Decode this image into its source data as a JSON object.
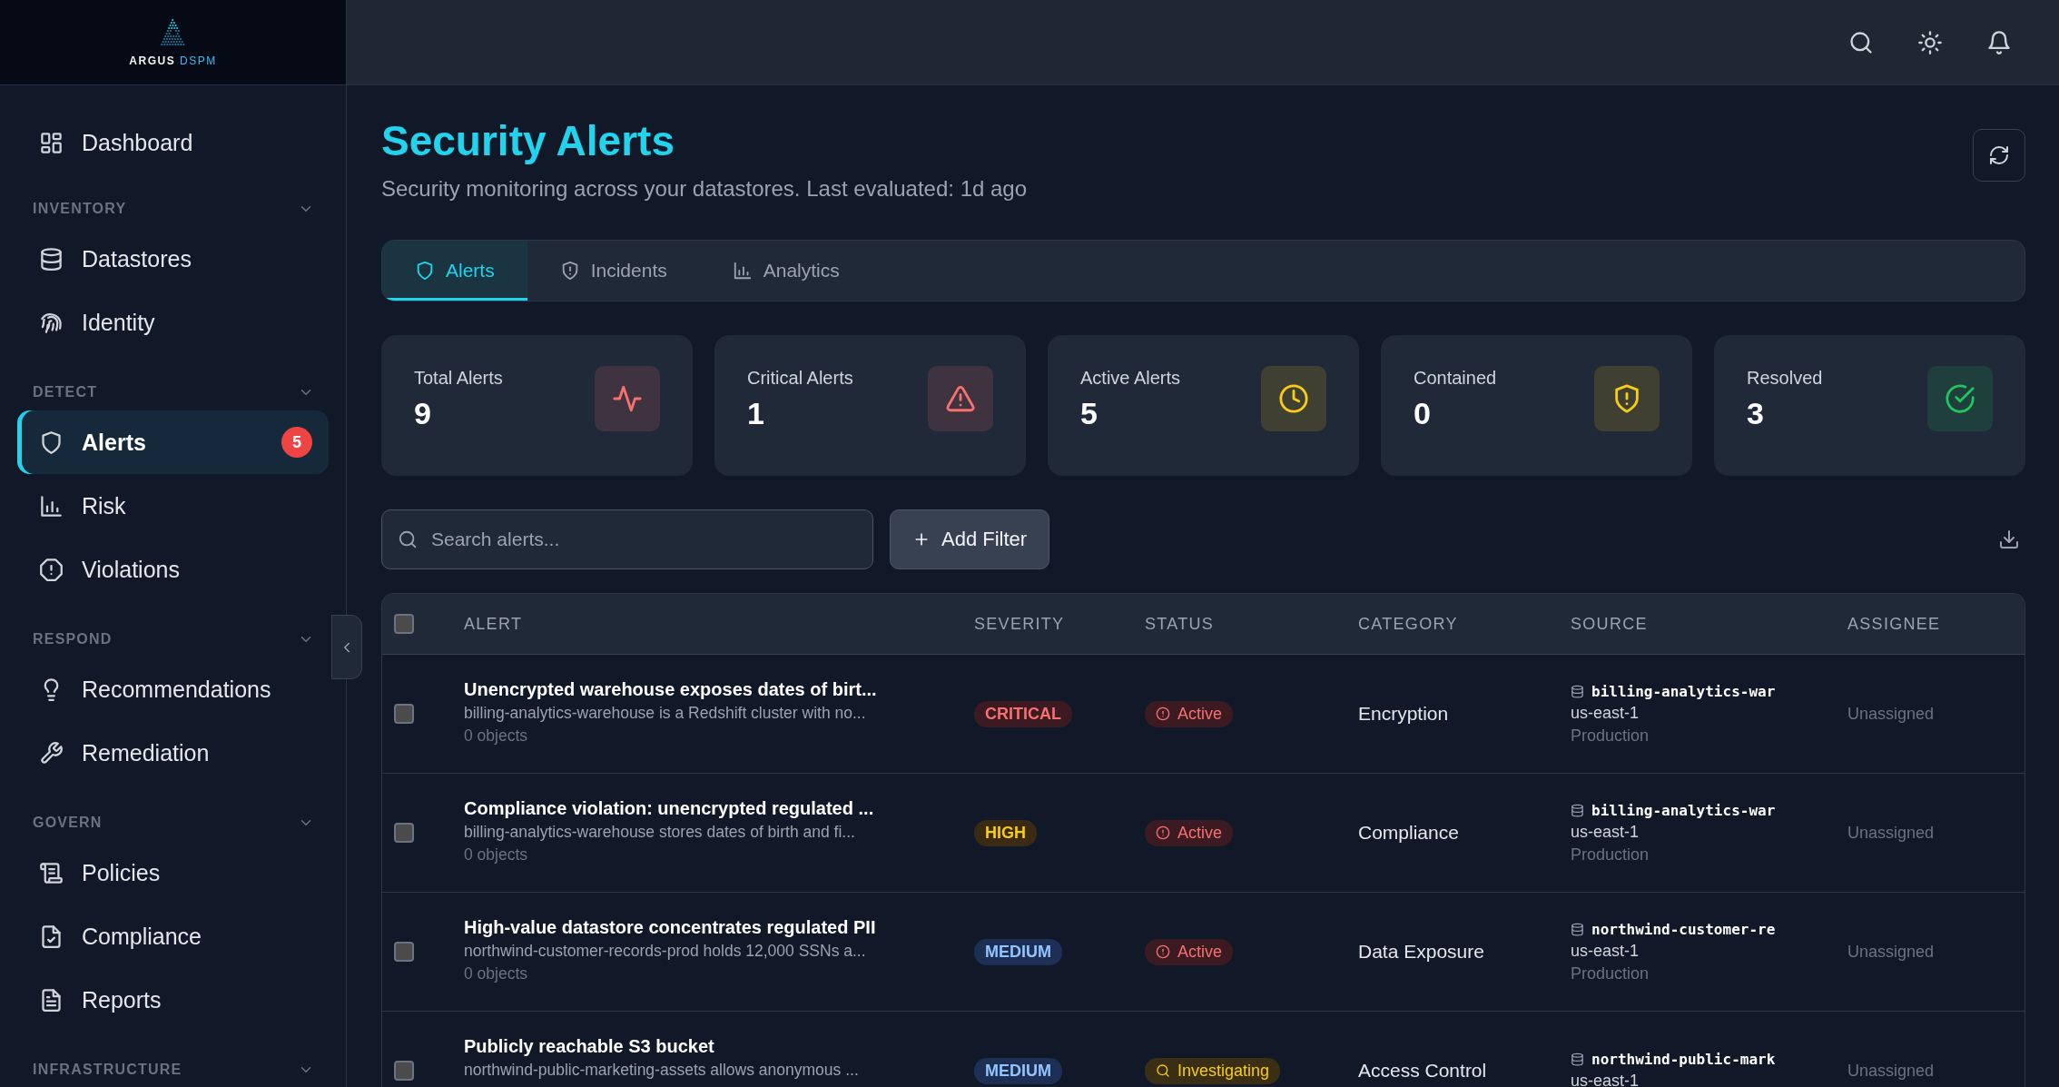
{
  "brand": {
    "name": "ARGUS",
    "product": "DSPM"
  },
  "sidebar": {
    "items": [
      {
        "label": "Dashboard",
        "selected": false
      }
    ],
    "sections": [
      {
        "label": "INVENTORY",
        "expanded": true,
        "items": [
          {
            "label": "Datastores",
            "selected": false
          },
          {
            "label": "Identity",
            "selected": false
          }
        ]
      },
      {
        "label": "DETECT",
        "expanded": true,
        "items": [
          {
            "label": "Alerts",
            "selected": true,
            "badge": "5"
          },
          {
            "label": "Risk",
            "selected": false
          },
          {
            "label": "Violations",
            "selected": false
          }
        ]
      },
      {
        "label": "RESPOND",
        "expanded": true,
        "items": [
          {
            "label": "Recommendations",
            "selected": false
          },
          {
            "label": "Remediation",
            "selected": false
          }
        ]
      },
      {
        "label": "GOVERN",
        "expanded": true,
        "items": [
          {
            "label": "Policies",
            "selected": false
          },
          {
            "label": "Compliance",
            "selected": false
          },
          {
            "label": "Reports",
            "selected": false
          }
        ]
      },
      {
        "label": "INFRASTRUCTURE",
        "expanded": true
      }
    ]
  },
  "header": {
    "title": "Security Alerts",
    "subtitle": "Security monitoring across your datastores. Last evaluated: 1d ago"
  },
  "tabs": [
    {
      "label": "Alerts",
      "selected": true
    },
    {
      "label": "Incidents",
      "selected": false
    },
    {
      "label": "Analytics",
      "selected": false
    }
  ],
  "stats": [
    {
      "label": "Total Alerts",
      "value": "9",
      "color": "#f87171"
    },
    {
      "label": "Critical Alerts",
      "value": "1",
      "color": "#f87171"
    },
    {
      "label": "Active Alerts",
      "value": "5",
      "color": "#facc15"
    },
    {
      "label": "Contained",
      "value": "0",
      "color": "#facc15"
    },
    {
      "label": "Resolved",
      "value": "3",
      "color": "#22c55e"
    }
  ],
  "toolbar": {
    "search": {
      "placeholder": "Search alerts..."
    },
    "add_filter": "Add Filter"
  },
  "table": {
    "select_all": {
      "checked": false
    },
    "columns": [
      "ALERT",
      "SEVERITY",
      "STATUS",
      "CATEGORY",
      "SOURCE",
      "ASSIGNEE"
    ],
    "rows": [
      {
        "checked": false,
        "title": "Unencrypted warehouse exposes dates of birt...",
        "description": "billing-analytics-warehouse is a Redshift cluster with no...",
        "meta": "0 objects",
        "severity": {
          "label": "CRITICAL",
          "kind": "critical"
        },
        "status": {
          "label": "Active",
          "kind": "active"
        },
        "category": "Encryption",
        "source": {
          "name": "billing-analytics-war",
          "region": "us-east-1",
          "environment": "Production"
        },
        "assignee": "Unassigned"
      },
      {
        "checked": false,
        "title": "Compliance violation: unencrypted regulated ...",
        "description": "billing-analytics-warehouse stores dates of birth and fi...",
        "meta": "0 objects",
        "severity": {
          "label": "HIGH",
          "kind": "high"
        },
        "status": {
          "label": "Active",
          "kind": "active"
        },
        "category": "Compliance",
        "source": {
          "name": "billing-analytics-war",
          "region": "us-east-1",
          "environment": "Production"
        },
        "assignee": "Unassigned"
      },
      {
        "checked": false,
        "title": "High-value datastore concentrates regulated PII",
        "description": "northwind-customer-records-prod holds 12,000 SSNs a...",
        "meta": "0 objects",
        "severity": {
          "label": "MEDIUM",
          "kind": "medium"
        },
        "status": {
          "label": "Active",
          "kind": "active"
        },
        "category": "Data Exposure",
        "source": {
          "name": "northwind-customer-re",
          "region": "us-east-1",
          "environment": "Production"
        },
        "assignee": "Unassigned"
      },
      {
        "checked": false,
        "title": "Publicly reachable S3 bucket",
        "description": "northwind-public-marketing-assets allows anonymous ...",
        "severity": {
          "label": "MEDIUM",
          "kind": "medium"
        },
        "status": {
          "label": "Investigating",
          "kind": "investigating"
        },
        "category": "Access Control",
        "source": {
          "name": "northwind-public-mark",
          "region": "us-east-1"
        },
        "assignee": "Unassigned"
      }
    ]
  }
}
